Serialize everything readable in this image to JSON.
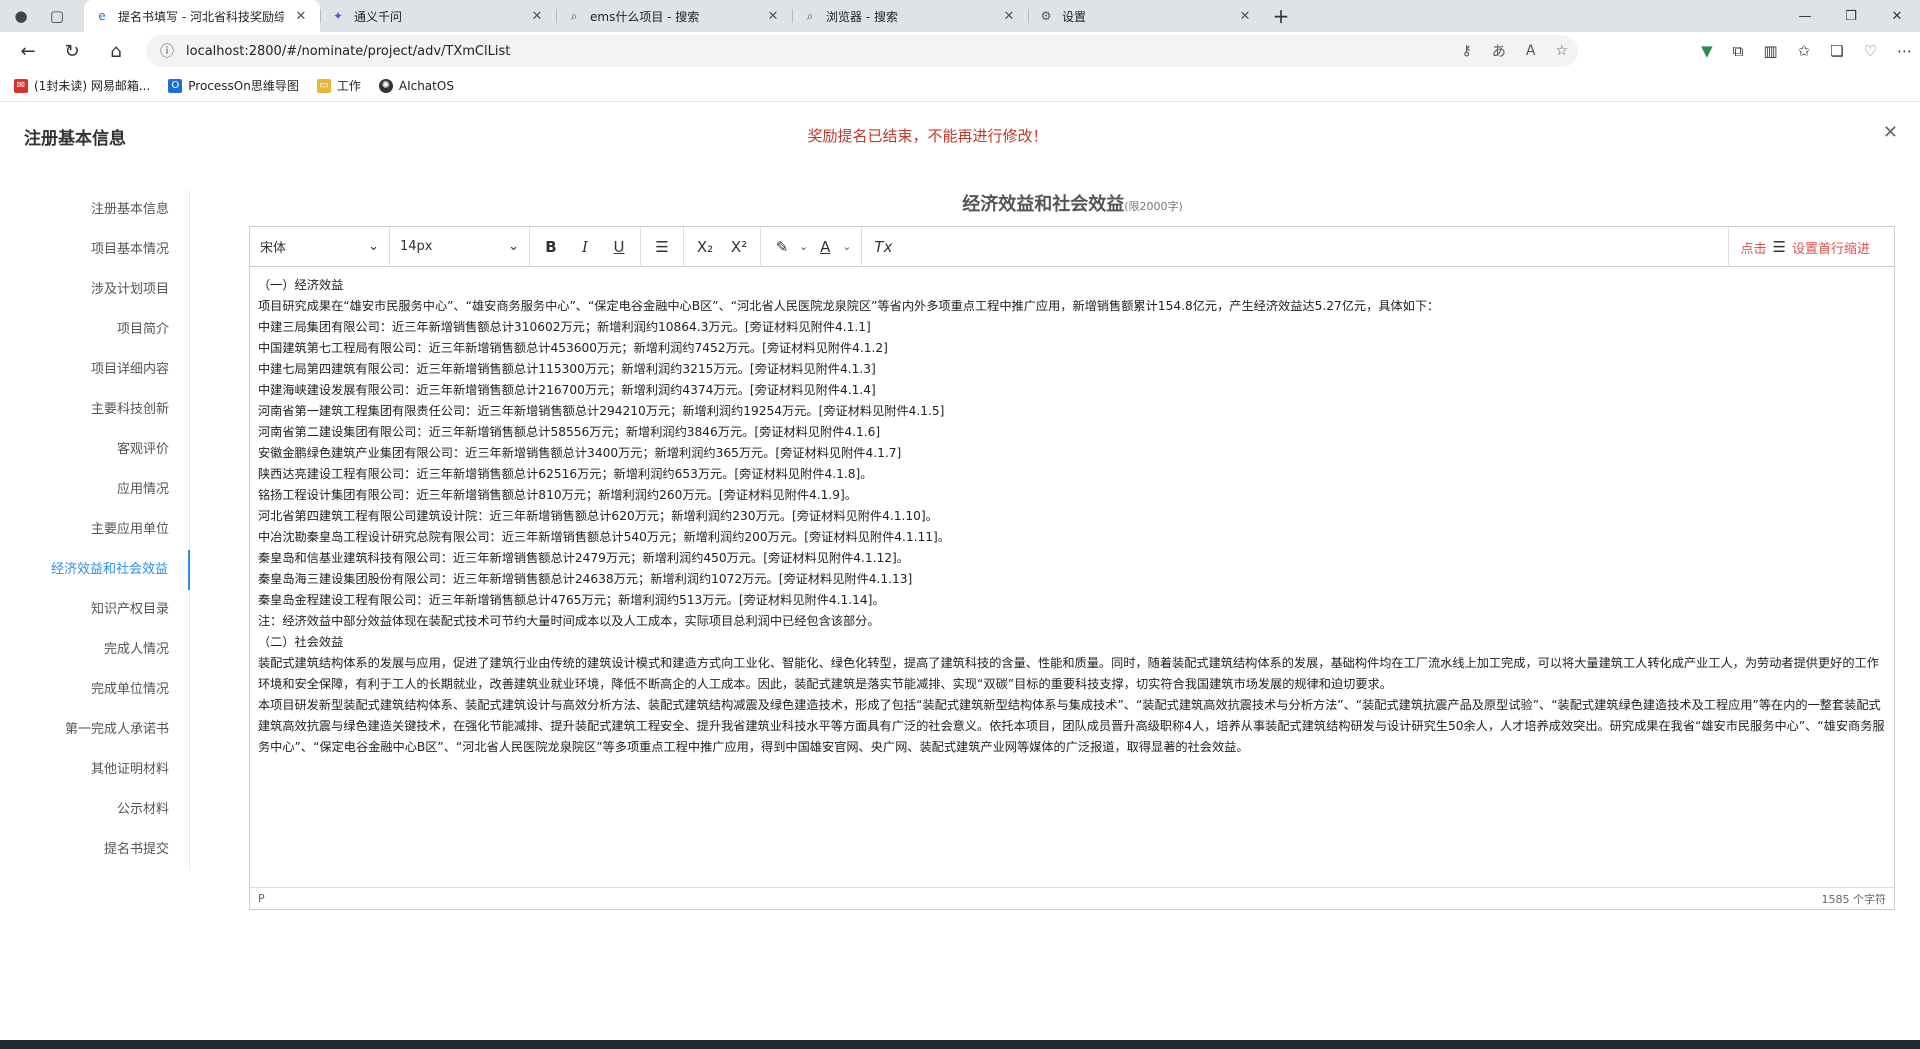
{
  "browser": {
    "tabs": [
      {
        "label": "提名书填写 - 河北省科技奖励综合",
        "icon": "ie-icon",
        "active": true
      },
      {
        "label": "通义千问",
        "icon": "tongyi-icon",
        "active": false
      },
      {
        "label": "ems什么项目 - 搜索",
        "icon": "search-icon",
        "active": false
      },
      {
        "label": "浏览器 - 搜索",
        "icon": "search-icon",
        "active": false
      },
      {
        "label": "设置",
        "icon": "gear-icon",
        "active": false
      }
    ],
    "url": "localhost:2800/#/nominate/project/adv/TXmClList",
    "bookmarks": [
      {
        "label": "(1封未读) 网易邮箱...",
        "icon": "netease-mail-icon"
      },
      {
        "label": "ProcessOn思维导图",
        "icon": "processon-icon"
      },
      {
        "label": "工作",
        "icon": "folder-icon"
      },
      {
        "label": "AIchatOS",
        "icon": "aichat-icon"
      }
    ]
  },
  "page": {
    "title": "注册基本信息",
    "alert": "奖励提名已结束，不能再进行修改！",
    "nav": [
      "注册基本信息",
      "项目基本情况",
      "涉及计划项目",
      "项目简介",
      "项目详细内容",
      "主要科技创新",
      "客观评价",
      "应用情况",
      "主要应用单位",
      "经济效益和社会效益",
      "知识产权目录",
      "完成人情况",
      "完成单位情况",
      "第一完成人承诺书",
      "其他证明材料",
      "公示材料",
      "提名书提交"
    ],
    "active_nav_index": 9,
    "section_title": "经济效益和社会效益",
    "section_limit": "(限2000字)"
  },
  "editor": {
    "font_family": "宋体",
    "font_size": "14px",
    "indent_prefix": "点击",
    "indent_label": "设置首行缩进",
    "paragraphs": [
      "（一）经济效益",
      "项目研究成果在“雄安市民服务中心”、“雄安商务服务中心”、“保定电谷金融中心B区”、“河北省人民医院龙泉院区”等省内外多项重点工程中推广应用，新增销售额累计154.8亿元，产生经济效益达5.27亿元，具体如下：",
      "中建三局集团有限公司：近三年新增销售额总计310602万元；新增利润约10864.3万元。[旁证材料见附件4.1.1]",
      "中国建筑第七工程局有限公司：近三年新增销售额总计453600万元；新增利润约7452万元。[旁证材料见附件4.1.2]",
      "中建七局第四建筑有限公司：近三年新增销售额总计115300万元；新增利润约3215万元。[旁证材料见附件4.1.3]",
      "中建海峡建设发展有限公司：近三年新增销售额总计216700万元；新增利润约4374万元。[旁证材料见附件4.1.4]",
      "河南省第一建筑工程集团有限责任公司：近三年新增销售额总计294210万元；新增利润约19254万元。[旁证材料见附件4.1.5]",
      "河南省第二建设集团有限公司：近三年新增销售额总计58556万元；新增利润约3846万元。[旁证材料见附件4.1.6]",
      "安徽金鹏绿色建筑产业集团有限公司：近三年新增销售额总计3400万元；新增利润约365万元。[旁证材料见附件4.1.7]",
      "陕西达亮建设工程有限公司：近三年新增销售额总计62516万元；新增利润约653万元。[旁证材料见附件4.1.8]。",
      "铭扬工程设计集团有限公司：近三年新增销售额总计810万元；新增利润约260万元。[旁证材料见附件4.1.9]。",
      "河北省第四建筑工程有限公司建筑设计院：近三年新增销售额总计620万元；新增利润约230万元。[旁证材料见附件4.1.10]。",
      "中冶沈勘秦皇岛工程设计研究总院有限公司：近三年新增销售额总计540万元；新增利润约200万元。[旁证材料见附件4.1.11]。",
      "秦皇岛和信基业建筑科技有限公司：近三年新增销售额总计2479万元；新增利润约450万元。[旁证材料见附件4.1.12]。",
      "秦皇岛海三建设集团股份有限公司：近三年新增销售额总计24638万元；新增利润约1072万元。[旁证材料见附件4.1.13]",
      "秦皇岛金程建设工程有限公司：近三年新增销售额总计4765万元；新增利润约513万元。[旁证材料见附件4.1.14]。",
      "注：经济效益中部分效益体现在装配式技术可节约大量时间成本以及人工成本，实际项目总利润中已经包含该部分。",
      "（二）社会效益",
      "装配式建筑结构体系的发展与应用，促进了建筑行业由传统的建筑设计模式和建造方式向工业化、智能化、绿色化转型，提高了建筑科技的含量、性能和质量。同时，随着装配式建筑结构体系的发展，基础构件均在工厂流水线上加工完成，可以将大量建筑工人转化成产业工人，为劳动者提供更好的工作环境和安全保障，有利于工人的长期就业，改善建筑业就业环境，降低不断高企的人工成本。因此，装配式建筑是落实节能减排、实现“双碳”目标的重要科技支撑，切实符合我国建筑市场发展的规律和迫切要求。",
      "本项目研发新型装配式建筑结构体系、装配式建筑设计与高效分析方法、装配式建筑结构减震及绿色建造技术，形成了包括“装配式建筑新型结构体系与集成技术”、“装配式建筑高效抗震技术与分析方法”、“装配式建筑抗震产品及原型试验”、“装配式建筑绿色建造技术及工程应用”等在内的一整套装配式建筑高效抗震与绿色建造关键技术，在强化节能减排、提升装配式建筑工程安全、提升我省建筑业科技水平等方面具有广泛的社会意义。依托本项目，团队成员晋升高级职称4人，培养从事装配式建筑结构研发与设计研究生50余人，人才培养成效突出。研究成果在我省“雄安市民服务中心”、“雄安商务服务中心”、“保定电谷金融中心B区”、“河北省人民医院龙泉院区”等多项重点工程中推广应用，得到中国雄安官网、央广网、装配式建筑产业网等媒体的广泛报道，取得显著的社会效益。"
    ],
    "status_path": "P",
    "char_count": "1585 个字符"
  }
}
